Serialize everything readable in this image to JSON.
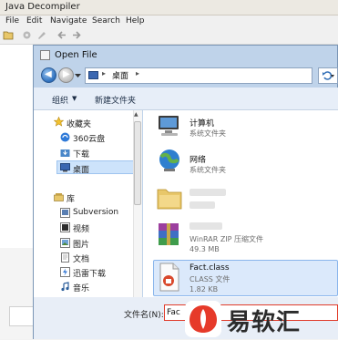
{
  "app": {
    "title": "Java Decompiler",
    "menu": [
      "File",
      "Edit",
      "Navigate",
      "Search",
      "Help"
    ]
  },
  "dialog": {
    "title": "Open File",
    "address": {
      "location": "桌面",
      "separator": "▸"
    },
    "commands": {
      "organize": "组织",
      "organize_caret": "▼",
      "new_folder": "新建文件夹"
    },
    "nav": {
      "favorites": "收藏夹",
      "items_fav": [
        "360云盘",
        "下载",
        "桌面"
      ],
      "library": "库",
      "items_lib": [
        "Subversion",
        "视频",
        "图片",
        "文档",
        "迅雷下载",
        "音乐"
      ]
    },
    "files": [
      {
        "name": "计算机",
        "type": "系统文件夹",
        "icon": "computer-icon"
      },
      {
        "name": "网络",
        "type": "系统文件夹",
        "icon": "network-icon"
      },
      {
        "name": "",
        "type": "",
        "icon": "folder-icon"
      },
      {
        "name": "",
        "type": "WinRAR ZIP 压缩文件",
        "size": "49.3 MB",
        "icon": "winrar-icon"
      },
      {
        "name": "Fact.class",
        "type": "CLASS 文件",
        "size": "1.82 KB",
        "icon": "class-file-icon"
      }
    ],
    "filename_label": "文件名(N):",
    "filename_value": "Fac"
  },
  "watermark": {
    "text": "易软汇"
  },
  "colors": {
    "accent": "#3b67b1",
    "selection": "#cde3fb",
    "dialog_frame": "#bfd3ea",
    "highlight_border": "#e03b2a"
  }
}
